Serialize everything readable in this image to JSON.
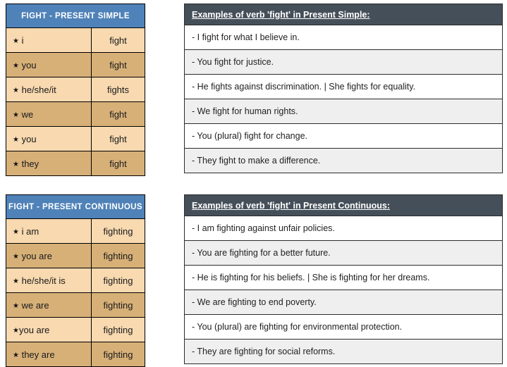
{
  "sections": [
    {
      "id": "present-simple",
      "conjugation": {
        "title": "FIGHT - PRESENT SIMPLE",
        "rows": [
          {
            "bullet": "★",
            "gap": " ",
            "pronoun": "i",
            "verb": "fight"
          },
          {
            "bullet": "★",
            "gap": " ",
            "pronoun": "you",
            "verb": "fight"
          },
          {
            "bullet": "★",
            "gap": " ",
            "pronoun": "he/she/it",
            "verb": "fights"
          },
          {
            "bullet": "★",
            "gap": " ",
            "pronoun": "we",
            "verb": "fight"
          },
          {
            "bullet": "★",
            "gap": " ",
            "pronoun": "you",
            "verb": "fight"
          },
          {
            "bullet": "★",
            "gap": " ",
            "pronoun": "they",
            "verb": "fight"
          }
        ]
      },
      "examples": {
        "title": "Examples of verb 'fight' in Present Simple:",
        "rows": [
          "- I fight for what I believe in.",
          "- You fight for justice.",
          "- He fights against discrimination. | She fights for equality.",
          "- We fight for human rights.",
          "- You (plural) fight for change.",
          "- They fight to make a difference."
        ]
      }
    },
    {
      "id": "present-continuous",
      "conjugation": {
        "title": "FIGHT - PRESENT CONTINUOUS",
        "rows": [
          {
            "bullet": "★",
            "gap": " ",
            "pronoun": "i am",
            "verb": "fighting"
          },
          {
            "bullet": "★",
            "gap": " ",
            "pronoun": "you are",
            "verb": "fighting"
          },
          {
            "bullet": "★",
            "gap": " ",
            "pronoun": "he/she/it is",
            "verb": "fighting"
          },
          {
            "bullet": "★",
            "gap": " ",
            "pronoun": "we are",
            "verb": "fighting"
          },
          {
            "bullet": "★",
            "gap": "",
            "pronoun": "you are",
            "verb": "fighting"
          },
          {
            "bullet": "★",
            "gap": " ",
            "pronoun": "they are",
            "verb": "fighting"
          }
        ]
      },
      "examples": {
        "title": "Examples of verb 'fight' in Present Continuous:",
        "rows": [
          "- I am fighting against unfair policies.",
          "- You are fighting for a better future.",
          "- He is fighting for his beliefs. | She is fighting for her dreams.",
          "- We are fighting to end poverty.",
          "- You (plural) are fighting for environmental protection.",
          "- They are fighting for social reforms."
        ]
      }
    }
  ],
  "colors": {
    "conjugation_header_blue": "#4f82b8",
    "examples_header_slate": "#454f59",
    "row_light_peach": "#f8d9b0",
    "row_dark_tan": "#d7b078",
    "row_white": "#ffffff",
    "row_gray": "#efefef",
    "border": "#000000",
    "text": "#1a1a1a"
  }
}
